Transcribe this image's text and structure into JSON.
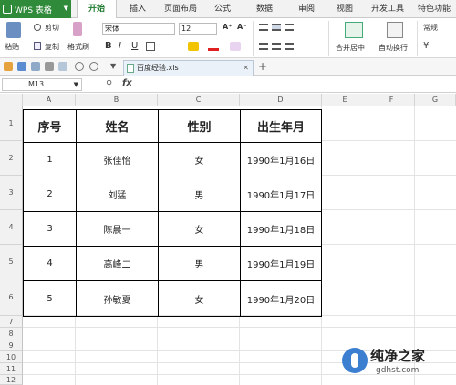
{
  "menubar": {
    "app_name": "WPS 表格",
    "tabs": [
      "开始",
      "插入",
      "页面布局",
      "公式",
      "数据",
      "审阅",
      "视图",
      "开发工具",
      "特色功能"
    ]
  },
  "ribbon": {
    "paste_label": "粘贴",
    "cut_label": "剪切",
    "copy_label": "复制",
    "format_painter_label": "格式刷",
    "font_name": "宋体",
    "font_size": "12",
    "grow_font": "A⁺",
    "shrink_font": "A⁻",
    "bold": "B",
    "italic": "I",
    "underline": "U",
    "merge_center_label": "合并居中",
    "wrap_text_label": "自动换行",
    "number_format": "常规",
    "currency_symbol": "¥"
  },
  "doc_tab": {
    "filename": "百度经验.xls"
  },
  "formula_bar": {
    "cell_ref": "M13",
    "fx_label": "fx"
  },
  "sheet": {
    "columns": [
      "A",
      "B",
      "C",
      "D",
      "E",
      "F",
      "G"
    ],
    "rows": [
      "1",
      "2",
      "3",
      "4",
      "5",
      "6",
      "7",
      "8",
      "9",
      "10",
      "11",
      "12"
    ],
    "headers": [
      "序号",
      "姓名",
      "性别",
      "出生年月"
    ],
    "data": [
      [
        "1",
        "张佳怡",
        "女",
        "1990年1月16日"
      ],
      [
        "2",
        "刘猛",
        "男",
        "1990年1月17日"
      ],
      [
        "3",
        "陈晨一",
        "女",
        "1990年1月18日"
      ],
      [
        "4",
        "高峰二",
        "男",
        "1990年1月19日"
      ],
      [
        "5",
        "孙敏夏",
        "女",
        "1990年1月20日"
      ]
    ]
  },
  "watermark": {
    "title": "纯净之家",
    "url": "gdhst.com"
  },
  "colors": {
    "accent": "#2f8a3a",
    "watermark_blue": "#3c7fd1"
  }
}
